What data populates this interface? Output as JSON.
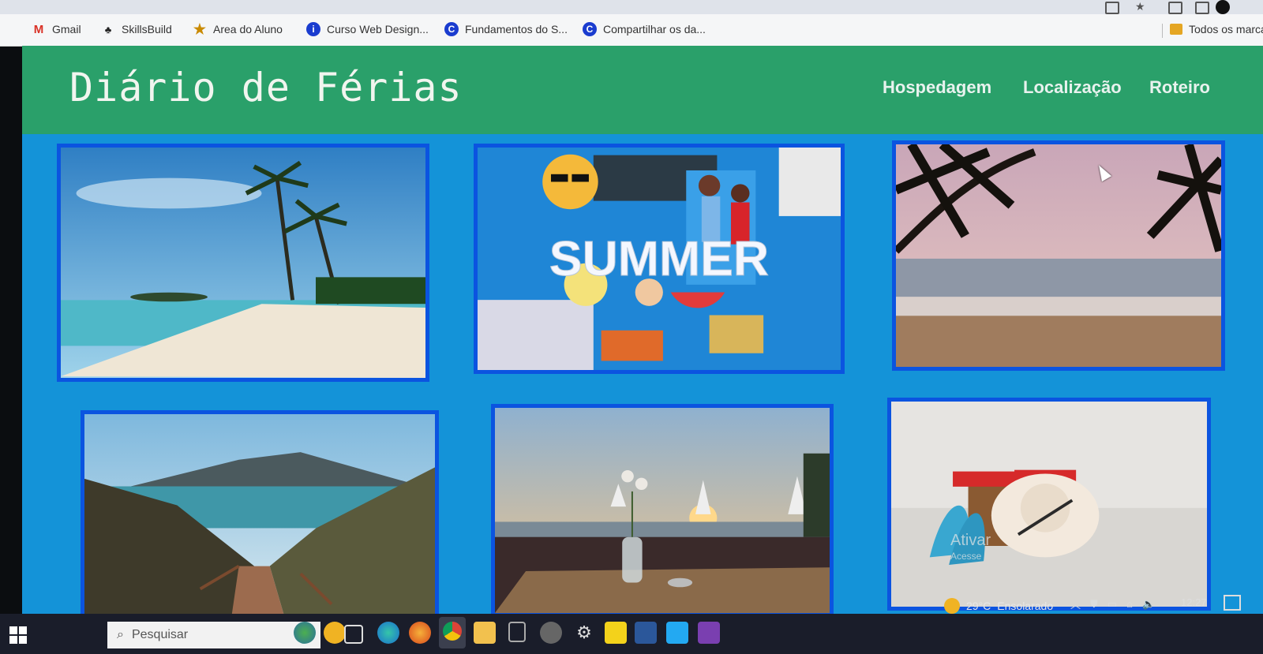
{
  "bookmarks": [
    {
      "label": "Gmail",
      "icon": "gmail-icon"
    },
    {
      "label": "SkillsBuild",
      "icon": "skillsbuild-icon"
    },
    {
      "label": "Area do Aluno",
      "icon": "star-icon"
    },
    {
      "label": "Curso Web Design...",
      "icon": "web-design-icon"
    },
    {
      "label": "Fundamentos do S...",
      "icon": "c-icon"
    },
    {
      "label": "Compartilhar os da...",
      "icon": "c-icon"
    },
    {
      "label": "Todos os marca",
      "icon": "folder-icon"
    }
  ],
  "site": {
    "title": "Diário de Férias",
    "nav": [
      {
        "label": "Hospedagem"
      },
      {
        "label": "Localização"
      },
      {
        "label": "Roteiro"
      }
    ],
    "header_color": "#2aa06a",
    "background_color": "#1493d8",
    "photo_border_color": "#0b54e0",
    "photos": [
      {
        "name": "tropical-beach-palms-photo",
        "overlay_text": ""
      },
      {
        "name": "summer-collage-photo",
        "overlay_text": "SUMMER"
      },
      {
        "name": "sunset-beach-palms-photo"
      },
      {
        "name": "mountain-trail-photo"
      },
      {
        "name": "seaside-cafe-sunset-photo"
      },
      {
        "name": "beach-hat-flipflops-photo"
      }
    ]
  },
  "overlay": {
    "activate_line1": "Ativar",
    "activate_line2": "Acesse"
  },
  "taskbar": {
    "search_placeholder": "Pesquisar",
    "temperature": "29°C",
    "weather": "Ensolarado",
    "time": "12:27"
  }
}
